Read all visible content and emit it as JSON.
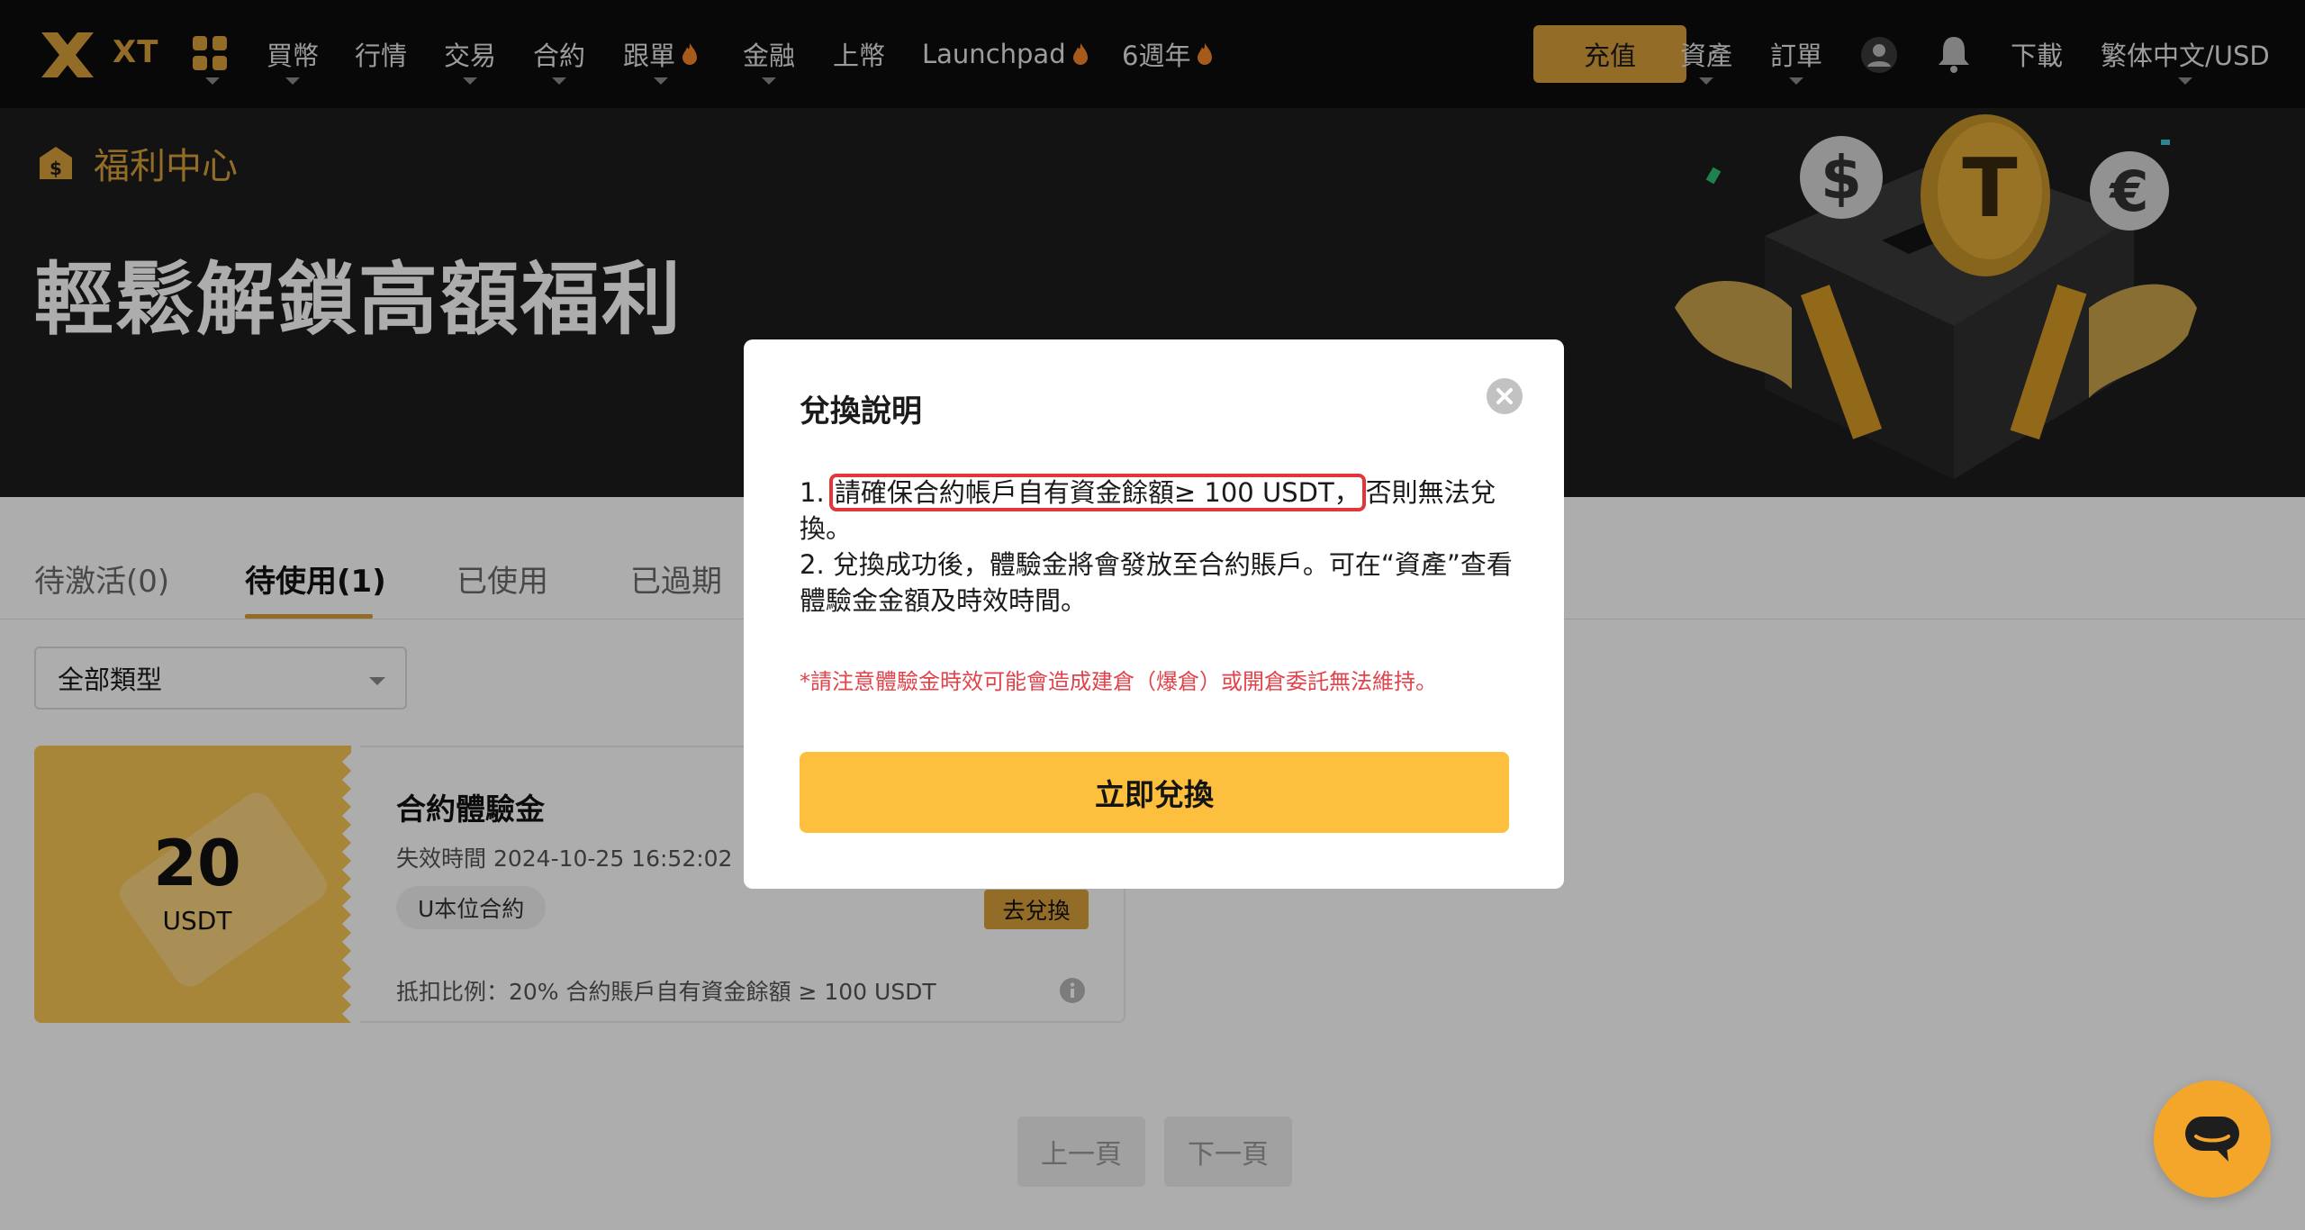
{
  "nav": {
    "logo_text": "XT",
    "items": [
      {
        "label": "買幣",
        "dropdown": true
      },
      {
        "label": "行情",
        "dropdown": false
      },
      {
        "label": "交易",
        "dropdown": true
      },
      {
        "label": "合約",
        "dropdown": true
      },
      {
        "label": "跟單",
        "dropdown": true,
        "hot": true
      },
      {
        "label": "金融",
        "dropdown": true
      },
      {
        "label": "上幣",
        "dropdown": false
      },
      {
        "label": "Launchpad",
        "dropdown": false,
        "hot": true
      },
      {
        "label": "6週年",
        "dropdown": false,
        "hot": true
      }
    ],
    "deposit_label": "充值",
    "assets_label": "資產",
    "orders_label": "訂單",
    "download_label": "下載",
    "locale_label": "繁体中文/USD"
  },
  "hero": {
    "breadcrumb": "福利中心",
    "title": "輕鬆解鎖高額福利"
  },
  "tabs": [
    {
      "label": "待激活(0)",
      "active": false
    },
    {
      "label": "待使用(1)",
      "active": true
    },
    {
      "label": "已使用",
      "active": false
    },
    {
      "label": "已過期",
      "active": false
    }
  ],
  "filter": {
    "selected": "全部類型"
  },
  "voucher": {
    "amount": "20",
    "unit": "USDT",
    "title": "合約體驗金",
    "expiry": "失效時間 2024-10-25 16:52:02",
    "tag": "U本位合約",
    "action_label": "去兌換",
    "footer": "抵扣比例：20%   合約賬戶自有資金餘額 ≥ 100 USDT"
  },
  "pagination": {
    "prev": "上一頁",
    "next": "下一頁"
  },
  "modal": {
    "title": "兌換說明",
    "line1_prefix": "1. ",
    "line1_highlight": "請確保合約帳戶自有資金餘額≥ 100 USDT，",
    "line1_suffix": "否則無法兌換。",
    "line2": "2. 兌換成功後，體驗金將會發放至合約賬戶。可在“資產”查看體驗金金額及時效時間。",
    "warning": "*請注意體驗金時效可能會造成建倉（爆倉）或開倉委託無法維持。",
    "cta_label": "立即兌換"
  },
  "colors": {
    "brand_gold": "#d9a13a",
    "cta_yellow": "#fcbf3e",
    "highlight_red": "#e2363a",
    "warning_red": "#e2434b"
  }
}
